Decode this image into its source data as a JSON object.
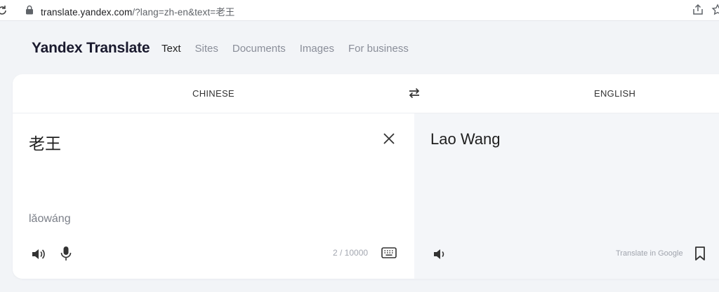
{
  "browser": {
    "url_host": "translate.yandex.com",
    "url_rest": "/?lang=zh-en&text=老王",
    "icons": [
      "reload-icon",
      "lock-icon",
      "share-icon",
      "star-icon"
    ]
  },
  "header": {
    "logo": "Yandex Translate",
    "nav": [
      "Text",
      "Sites",
      "Documents",
      "Images",
      "For business"
    ],
    "active_nav": "Text"
  },
  "translator": {
    "source_lang": "CHINESE",
    "target_lang": "ENGLISH",
    "source_text": "老王",
    "transliteration": "lǎowáng",
    "counter": "2 / 10000",
    "translation": "Lao Wang",
    "translate_in_google": "Translate in Google"
  },
  "colors": {
    "page_bg": "#f2f4f7",
    "card_bg": "#ffffff",
    "target_pane_bg": "#f4f6f9",
    "nav_inactive": "#8a8e99",
    "text_primary": "#1f1f1f"
  }
}
